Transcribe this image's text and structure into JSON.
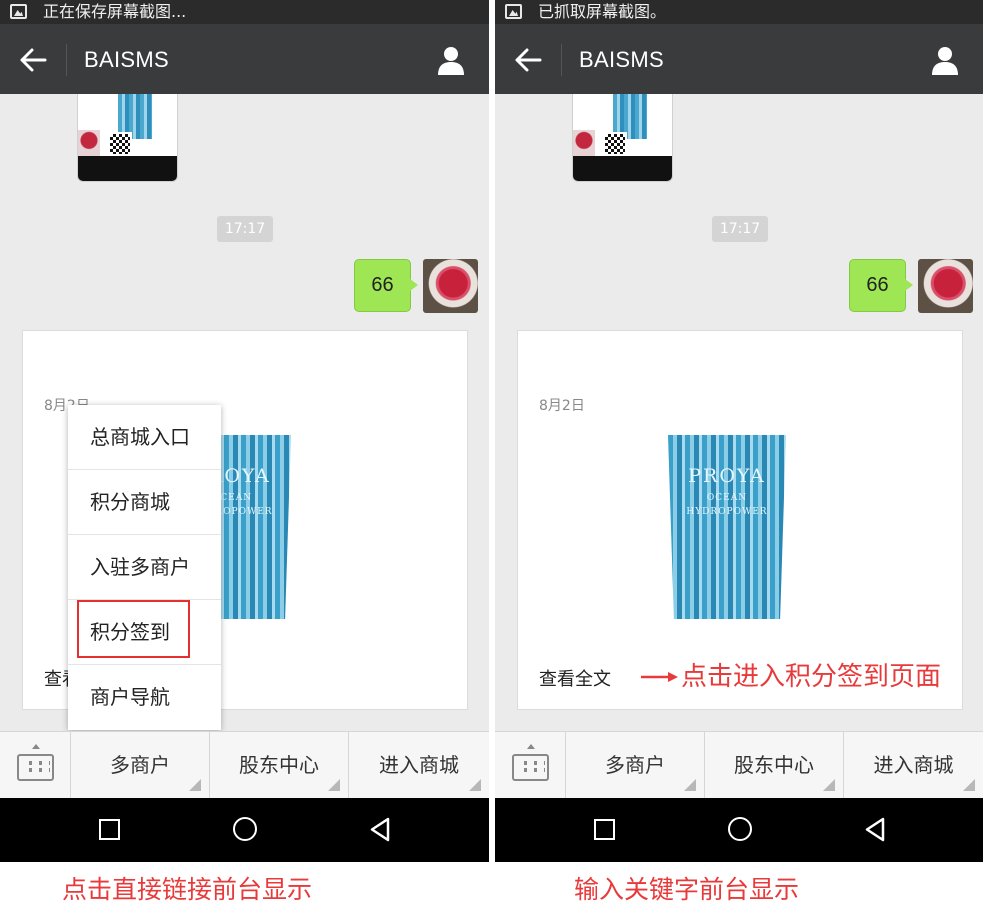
{
  "left": {
    "status_text": "正在保存屏幕截图...",
    "title": "BAISMS",
    "time_badge": "17:17",
    "bubble_text": "66",
    "card": {
      "date": "8月2日",
      "brand": "PROYA",
      "brand_sub": "OCEAN HYDROPOWER",
      "read_all": "查看全文"
    },
    "popup_items": [
      "总商城入口",
      "积分商城",
      "入驻多商户",
      "积分签到",
      "商户导航"
    ],
    "menu": [
      "多商户",
      "股东中心",
      "进入商城"
    ],
    "caption": "点击直接链接前台显示"
  },
  "right": {
    "status_text": "已抓取屏幕截图。",
    "title": "BAISMS",
    "time_badge": "17:17",
    "bubble_text": "66",
    "card": {
      "date": "8月2日",
      "brand": "PROYA",
      "brand_sub": "OCEAN HYDROPOWER",
      "read_all": "查看全文"
    },
    "annotation": "点击进入积分签到页面",
    "menu": [
      "多商户",
      "股东中心",
      "进入商城"
    ],
    "caption": "输入关键字前台显示"
  },
  "colors": {
    "title_bar": "#3a3b3d",
    "status_bar": "#2b2b2b",
    "chat_bg": "#ebebeb",
    "bubble_green": "#9ee653",
    "annotation_red": "#e83a3a",
    "highlight_red": "#e53030"
  },
  "icons": [
    "image-icon",
    "back-arrow-icon",
    "person-icon",
    "keyboard-icon",
    "nav-recent-icon",
    "nav-home-icon",
    "nav-back-icon"
  ]
}
